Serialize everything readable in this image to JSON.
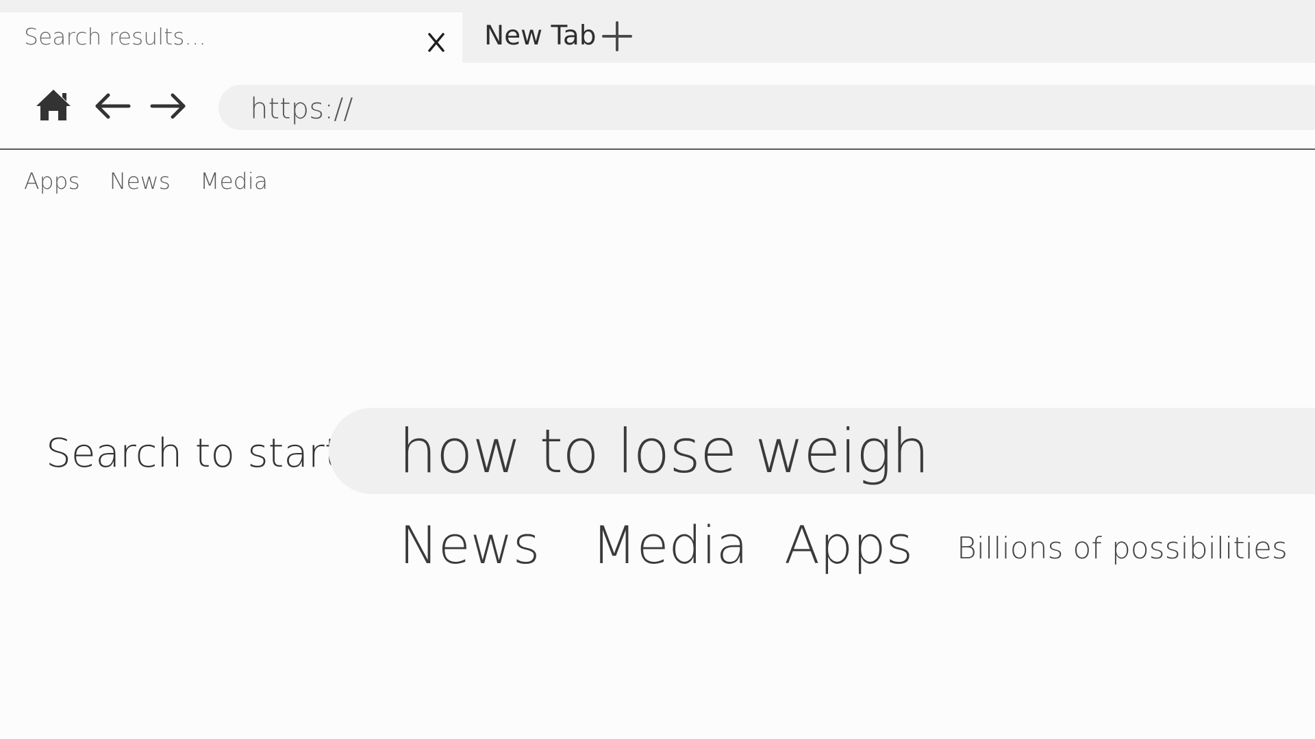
{
  "tabs": {
    "active": {
      "title": "Search results..."
    },
    "new_tab": {
      "label": "New Tab"
    }
  },
  "address_bar": {
    "url": "https://"
  },
  "bookmarks": [
    {
      "label": "Apps"
    },
    {
      "label": "News"
    },
    {
      "label": "Media"
    }
  ],
  "search": {
    "label": "Search to start",
    "query": "how to lose weigh"
  },
  "quick_links": [
    {
      "label": "News"
    },
    {
      "label": "Media"
    },
    {
      "label": "Apps"
    }
  ],
  "tagline": "Billions of possibilities",
  "icons": {
    "close": "close-icon",
    "new_tab": "plus-icon",
    "home": "home-icon",
    "back": "arrow-left-icon",
    "forward": "arrow-right-icon"
  },
  "colors": {
    "background": "#fcfcfc",
    "chrome": "#f0f0f1",
    "text": "#3a3a3a",
    "divider": "#5a5a5a"
  }
}
